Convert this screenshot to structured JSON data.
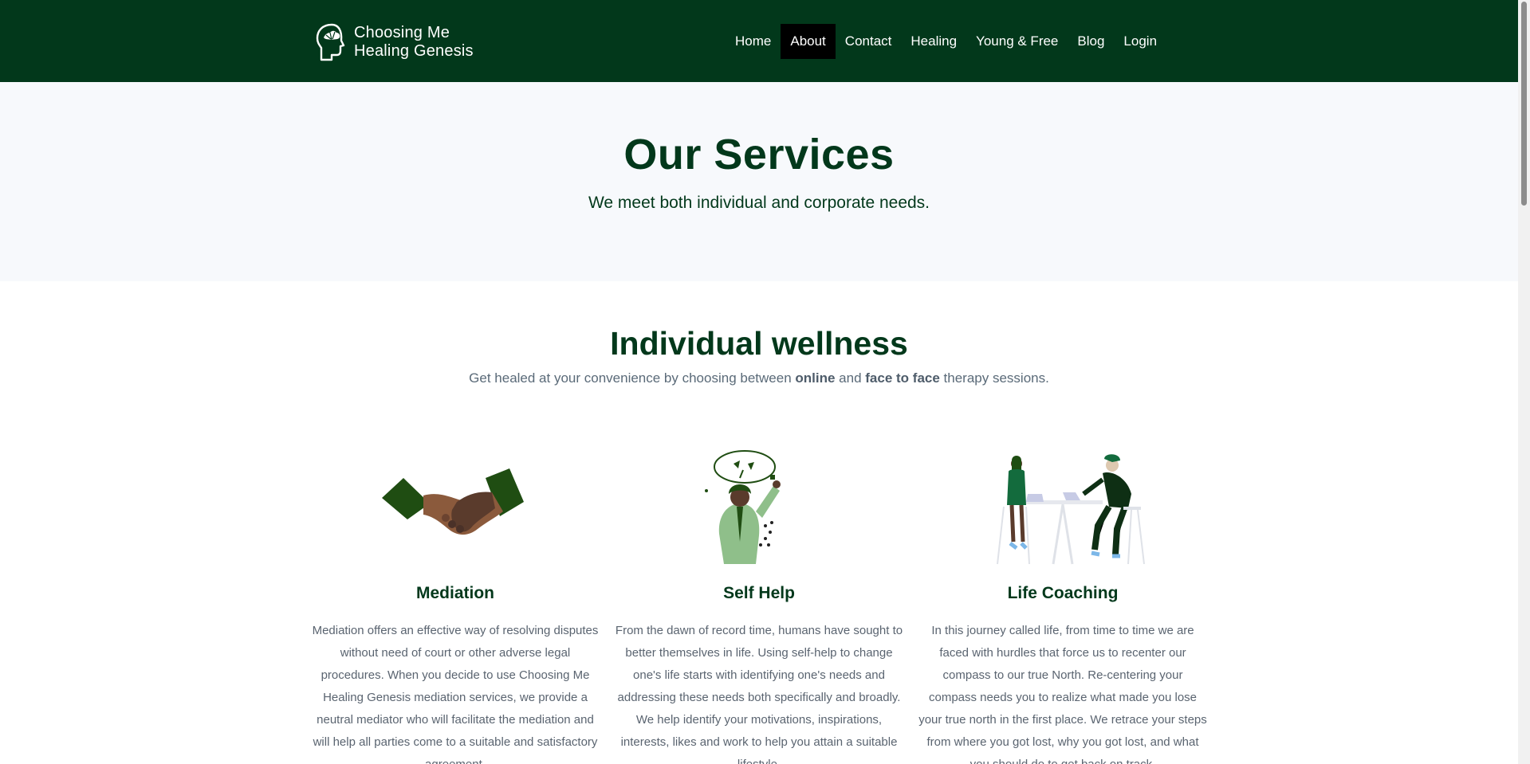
{
  "brand": {
    "line1": "Choosing Me",
    "line2": "Healing Genesis",
    "icon": "head-tree-logo"
  },
  "nav": {
    "items": [
      {
        "label": "Home",
        "active": false
      },
      {
        "label": "About",
        "active": true
      },
      {
        "label": "Contact",
        "active": false
      },
      {
        "label": "Healing",
        "active": false
      },
      {
        "label": "Young & Free",
        "active": false
      },
      {
        "label": "Blog",
        "active": false
      },
      {
        "label": "Login",
        "active": false
      }
    ]
  },
  "hero": {
    "title": "Our Services",
    "subtitle": "We meet both individual and corporate needs."
  },
  "section": {
    "title": "Individual wellness",
    "subtitle_pre": "Get healed at your convenience by choosing between ",
    "subtitle_bold1": "online",
    "subtitle_mid": " and ",
    "subtitle_bold2": "face to face",
    "subtitle_post": " therapy sessions."
  },
  "cards": [
    {
      "icon": "handshake-illustration",
      "title": "Mediation",
      "body": "Mediation offers an effective way of resolving disputes without need of court or other adverse legal procedures. When you decide to use Choosing Me Healing Genesis mediation services, we provide a neutral mediator who will facilitate the mediation and will help all parties come to a suitable and satisfactory agreement."
    },
    {
      "icon": "self-help-illustration",
      "title": "Self Help",
      "body": "From the dawn of record time, humans have sought to better themselves in life. Using self-help to change one's life starts with identifying one's needs and addressing these needs both specifically and broadly. We help identify your motivations, inspirations, interests, likes and work to help you attain a suitable lifestyle."
    },
    {
      "icon": "coaching-illustration",
      "title": "Life Coaching",
      "body": "In this journey called life, from time to time we are faced with hurdles that force us to recenter our compass to our true North. Re-centering your compass needs you to realize what made you lose your true north in the first place. We retrace your steps from where you got lost, why you got lost, and what you should do to get back on track."
    }
  ],
  "colors": {
    "header": "#02381b",
    "accent": "#02381b",
    "hero_bg": "#f7f9fc",
    "active_nav": "#000000"
  }
}
